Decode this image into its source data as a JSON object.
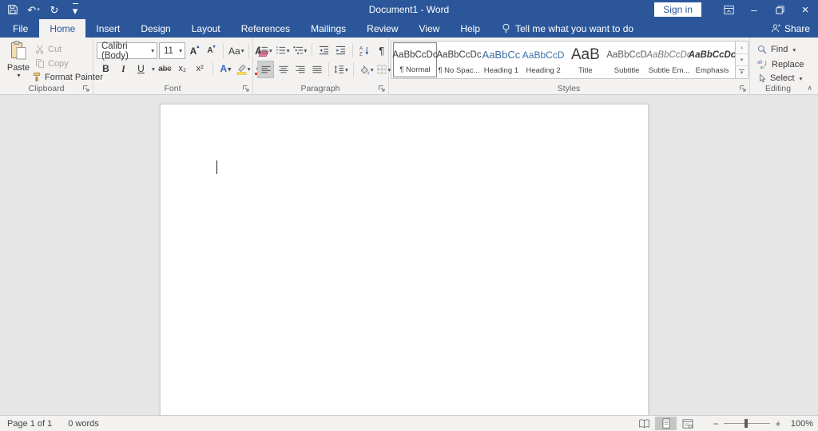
{
  "colors": {
    "titlebar_blue": "#2b579a",
    "ribbon_bg": "#f3f2f1",
    "document_bg": "#e6e6e6",
    "heading_blue": "#3b6ea5",
    "selected_gray": "#c8c6c4"
  },
  "titlebar": {
    "title": "Document1  -  Word",
    "sign_in_label": "Sign in"
  },
  "tabs": {
    "items": [
      "File",
      "Home",
      "Insert",
      "Design",
      "Layout",
      "References",
      "Mailings",
      "Review",
      "View",
      "Help"
    ],
    "active_tab": "Home",
    "tell_me": "Tell me what you want to do",
    "share_label": "Share"
  },
  "glyphs": {
    "dropdown": "▾",
    "undo": "↶",
    "redo": "↻",
    "pilcrow": "¶",
    "minimize": "–",
    "close": "×",
    "collapse_ribbon": "∧",
    "zoom_out": "−",
    "zoom_in": "+",
    "scroll_up": "▴",
    "scroll_down": "▾"
  },
  "ribbon": {
    "clipboard": {
      "group_label": "Clipboard",
      "paste_label": "Paste",
      "cut_label": "Cut",
      "copy_label": "Copy",
      "format_painter_label": "Format Painter"
    },
    "font": {
      "group_label": "Font",
      "font_name": "Calibri (Body)",
      "font_size": "11",
      "grow_font_label": "A",
      "shrink_font_label": "A",
      "change_case_label": "Aa",
      "clear_formatting_label": "A",
      "bold_label": "B",
      "italic_label": "I",
      "underline_label": "U",
      "strikethrough_label": "abc",
      "subscript_label": "x₂",
      "superscript_label": "x²",
      "text_effects_label": "A",
      "font_color_label": "A"
    },
    "paragraph": {
      "group_label": "Paragraph"
    },
    "styles": {
      "group_label": "Styles",
      "items": [
        {
          "preview": "AaBbCcDc",
          "name": "¶ Normal",
          "selected": true
        },
        {
          "preview": "AaBbCcDc",
          "name": "¶ No Spac...",
          "selected": false
        },
        {
          "preview": "AaBbCc",
          "name": "Heading 1",
          "selected": false
        },
        {
          "preview": "AaBbCcD",
          "name": "Heading 2",
          "selected": false
        },
        {
          "preview": "AaB",
          "name": "Title",
          "selected": false
        },
        {
          "preview": "AaBbCcD",
          "name": "Subtitle",
          "selected": false
        },
        {
          "preview": "AaBbCcDc",
          "name": "Subtle Em...",
          "selected": false
        },
        {
          "preview": "AaBbCcDc",
          "name": "Emphasis",
          "selected": false
        }
      ]
    },
    "editing": {
      "group_label": "Editing",
      "find_label": "Find",
      "replace_label": "Replace",
      "select_label": "Select"
    }
  },
  "statusbar": {
    "page_indicator": "Page 1 of 1",
    "word_count": "0 words",
    "zoom_level": "100%"
  }
}
